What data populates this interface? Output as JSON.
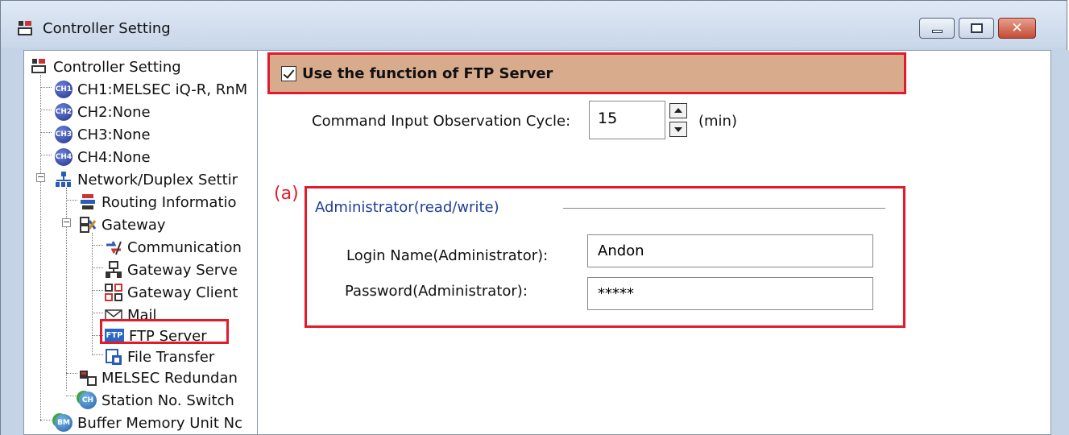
{
  "window": {
    "title": "Controller Setting",
    "icon": "controller-setting-icon"
  },
  "tree": {
    "items": [
      {
        "label": "Controller Setting",
        "icon": "controller-icon"
      },
      {
        "label": "CH1:MELSEC iQ-R, RnM",
        "icon": "ch1-icon",
        "badge": "CH1"
      },
      {
        "label": "CH2:None",
        "icon": "ch2-icon",
        "badge": "CH2"
      },
      {
        "label": "CH3:None",
        "icon": "ch3-icon",
        "badge": "CH3"
      },
      {
        "label": "CH4:None",
        "icon": "ch4-icon",
        "badge": "CH4"
      },
      {
        "label": "Network/Duplex Settir",
        "icon": "network-icon"
      },
      {
        "label": "Routing Informatio",
        "icon": "routing-icon"
      },
      {
        "label": "Gateway",
        "icon": "gateway-icon"
      },
      {
        "label": "Communication",
        "icon": "communication-icon"
      },
      {
        "label": "Gateway Serve",
        "icon": "gateway-server-icon"
      },
      {
        "label": "Gateway Client",
        "icon": "gateway-client-icon"
      },
      {
        "label": "Mail",
        "icon": "mail-icon"
      },
      {
        "label": "FTP Server",
        "icon": "ftp-icon",
        "badge": "FTP"
      },
      {
        "label": "File Transfer",
        "icon": "file-transfer-icon"
      },
      {
        "label": "MELSEC Redundan",
        "icon": "redundant-icon"
      },
      {
        "label": "Station No. Switch",
        "icon": "station-switch-icon",
        "badge": "CH"
      },
      {
        "label": "Buffer Memory Unit Nc",
        "icon": "buffer-memory-icon",
        "badge": "BM"
      }
    ]
  },
  "ftp": {
    "use_label": "Use the function of FTP Server",
    "use_checked": true,
    "cycle_label": "Command Input Observation Cycle:",
    "cycle_value": "15",
    "cycle_unit": "(min)"
  },
  "annotation": "(a)",
  "admin": {
    "group_title": "Administrator(read/write)",
    "login_label": "Login Name(Administrator):",
    "login_value": "Andon",
    "password_label": "Password(Administrator):",
    "password_value": "*****"
  },
  "colors": {
    "highlight": "#e11b2b",
    "ftp_bar": "#d8ab8d",
    "group_title": "#1d3e9a"
  }
}
